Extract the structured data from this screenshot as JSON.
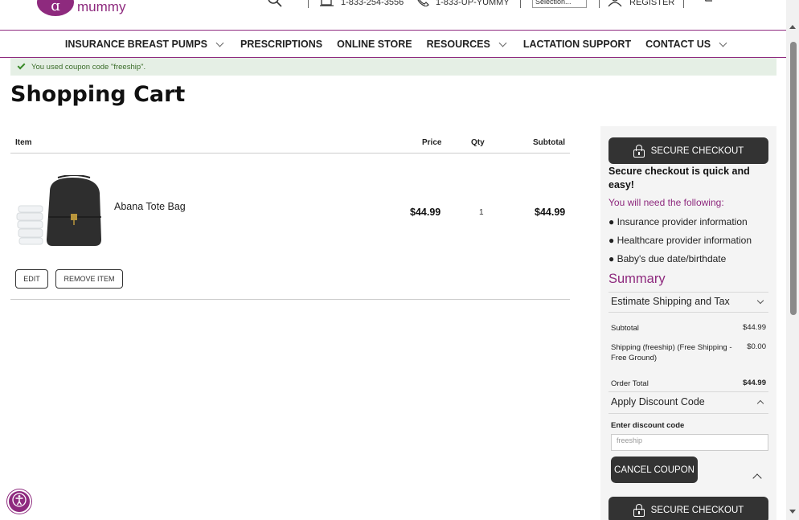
{
  "brand": {
    "logo_text": "mummy",
    "logo_glyph": "ɑ",
    "color": "#8e2a7e"
  },
  "topbar": {
    "phone": "1-833-254-3556",
    "phone2": "1-833-UP-YUMMY",
    "select_value": "Selection...",
    "register": "REGISTER"
  },
  "nav": {
    "items": [
      {
        "label": "INSURANCE BREAST PUMPS",
        "has_dropdown": true
      },
      {
        "label": "PRESCRIPTIONS",
        "has_dropdown": false
      },
      {
        "label": "ONLINE STORE",
        "has_dropdown": false
      },
      {
        "label": "RESOURCES",
        "has_dropdown": true
      },
      {
        "label": "LACTATION SUPPORT",
        "has_dropdown": false
      },
      {
        "label": "CONTACT US",
        "has_dropdown": true
      }
    ]
  },
  "message": {
    "text": "You used coupon code \"freeship\".",
    "color": "#3b6d2a"
  },
  "page": {
    "title": "Shopping Cart"
  },
  "cart": {
    "headers": {
      "item": "Item",
      "price": "Price",
      "qty": "Qty",
      "subtotal": "Subtotal"
    },
    "items": [
      {
        "name": "Abana Tote Bag",
        "price": "$44.99",
        "qty": "1",
        "subtotal": "$44.99"
      }
    ],
    "edit_label": "EDIT",
    "remove_label": "REMOVE ITEM"
  },
  "sidebar": {
    "checkout_label": "SECURE CHECKOUT",
    "quick_text": "Secure checkout is quick and easy!",
    "need_text": "You will need the following:",
    "needs": [
      "Insurance provider information",
      "Healthcare provider information",
      "Baby's due date/birthdate"
    ],
    "summary_title": "Summary",
    "estimate_label": "Estimate Shipping and Tax",
    "subtotal_label": "Subtotal",
    "subtotal_value": "$44.99",
    "shipping_label": "Shipping (freeship) (Free Shipping - Free Ground)",
    "shipping_value": "$0.00",
    "order_total_label": "Order Total",
    "order_total_value": "$44.99",
    "discount_title": "Apply Discount Code",
    "discount_field_label": "Enter discount code",
    "discount_value": "freeship",
    "cancel_coupon_label": "CANCEL COUPON"
  }
}
